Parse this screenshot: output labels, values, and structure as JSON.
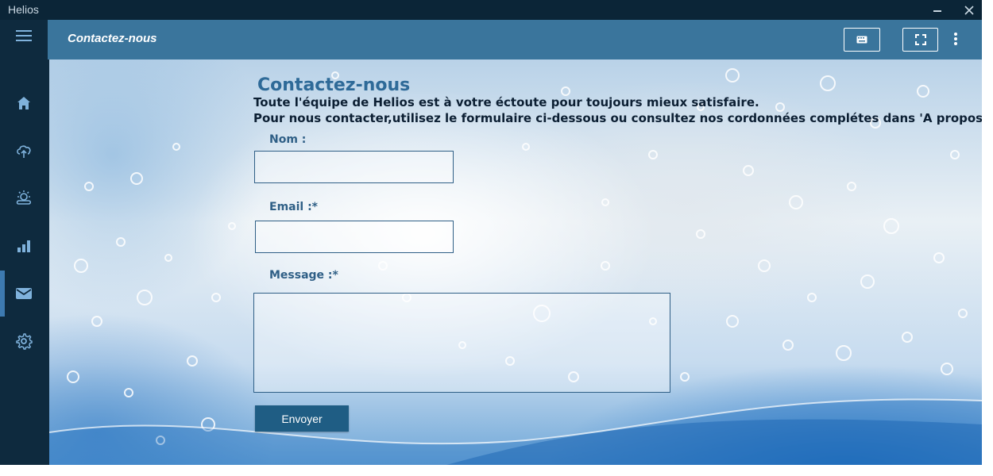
{
  "window": {
    "app_title": "Helios",
    "minimize_icon": "minimize-icon",
    "close_icon": "close-icon"
  },
  "sidebar": {
    "menu_icon": "hamburger-icon",
    "items": [
      {
        "icon": "home-icon",
        "active": false
      },
      {
        "icon": "cloud-upload-icon",
        "active": false
      },
      {
        "icon": "weather-icon",
        "active": false
      },
      {
        "icon": "chart-icon",
        "active": false
      },
      {
        "icon": "mail-icon",
        "active": true
      },
      {
        "icon": "gear-icon",
        "active": false
      }
    ]
  },
  "header": {
    "title": "Contactez-nous",
    "keyboard_icon": "keyboard-icon",
    "fullscreen_icon": "fullscreen-icon",
    "more_icon": "more-vertical-icon"
  },
  "form": {
    "title": "Contactez-nous",
    "description_line1": "Toute l'équipe de Helios est à votre éctoute pour toujours mieux satisfaire.",
    "description_line2": "Pour nous contacter,utilisez le formulaire ci-dessous ou consultez nos cordonnées complétes dans 'A propos'",
    "name_label": "Nom :",
    "name_value": "",
    "email_label": "Email :*",
    "email_value": "",
    "message_label": "Message :*",
    "message_value": "",
    "submit_label": "Envoyer"
  },
  "colors": {
    "sidebar_bg": "#0e2a3e",
    "header_bg": "#3a759c",
    "accent": "#1f5d84",
    "label": "#2f5f86"
  }
}
